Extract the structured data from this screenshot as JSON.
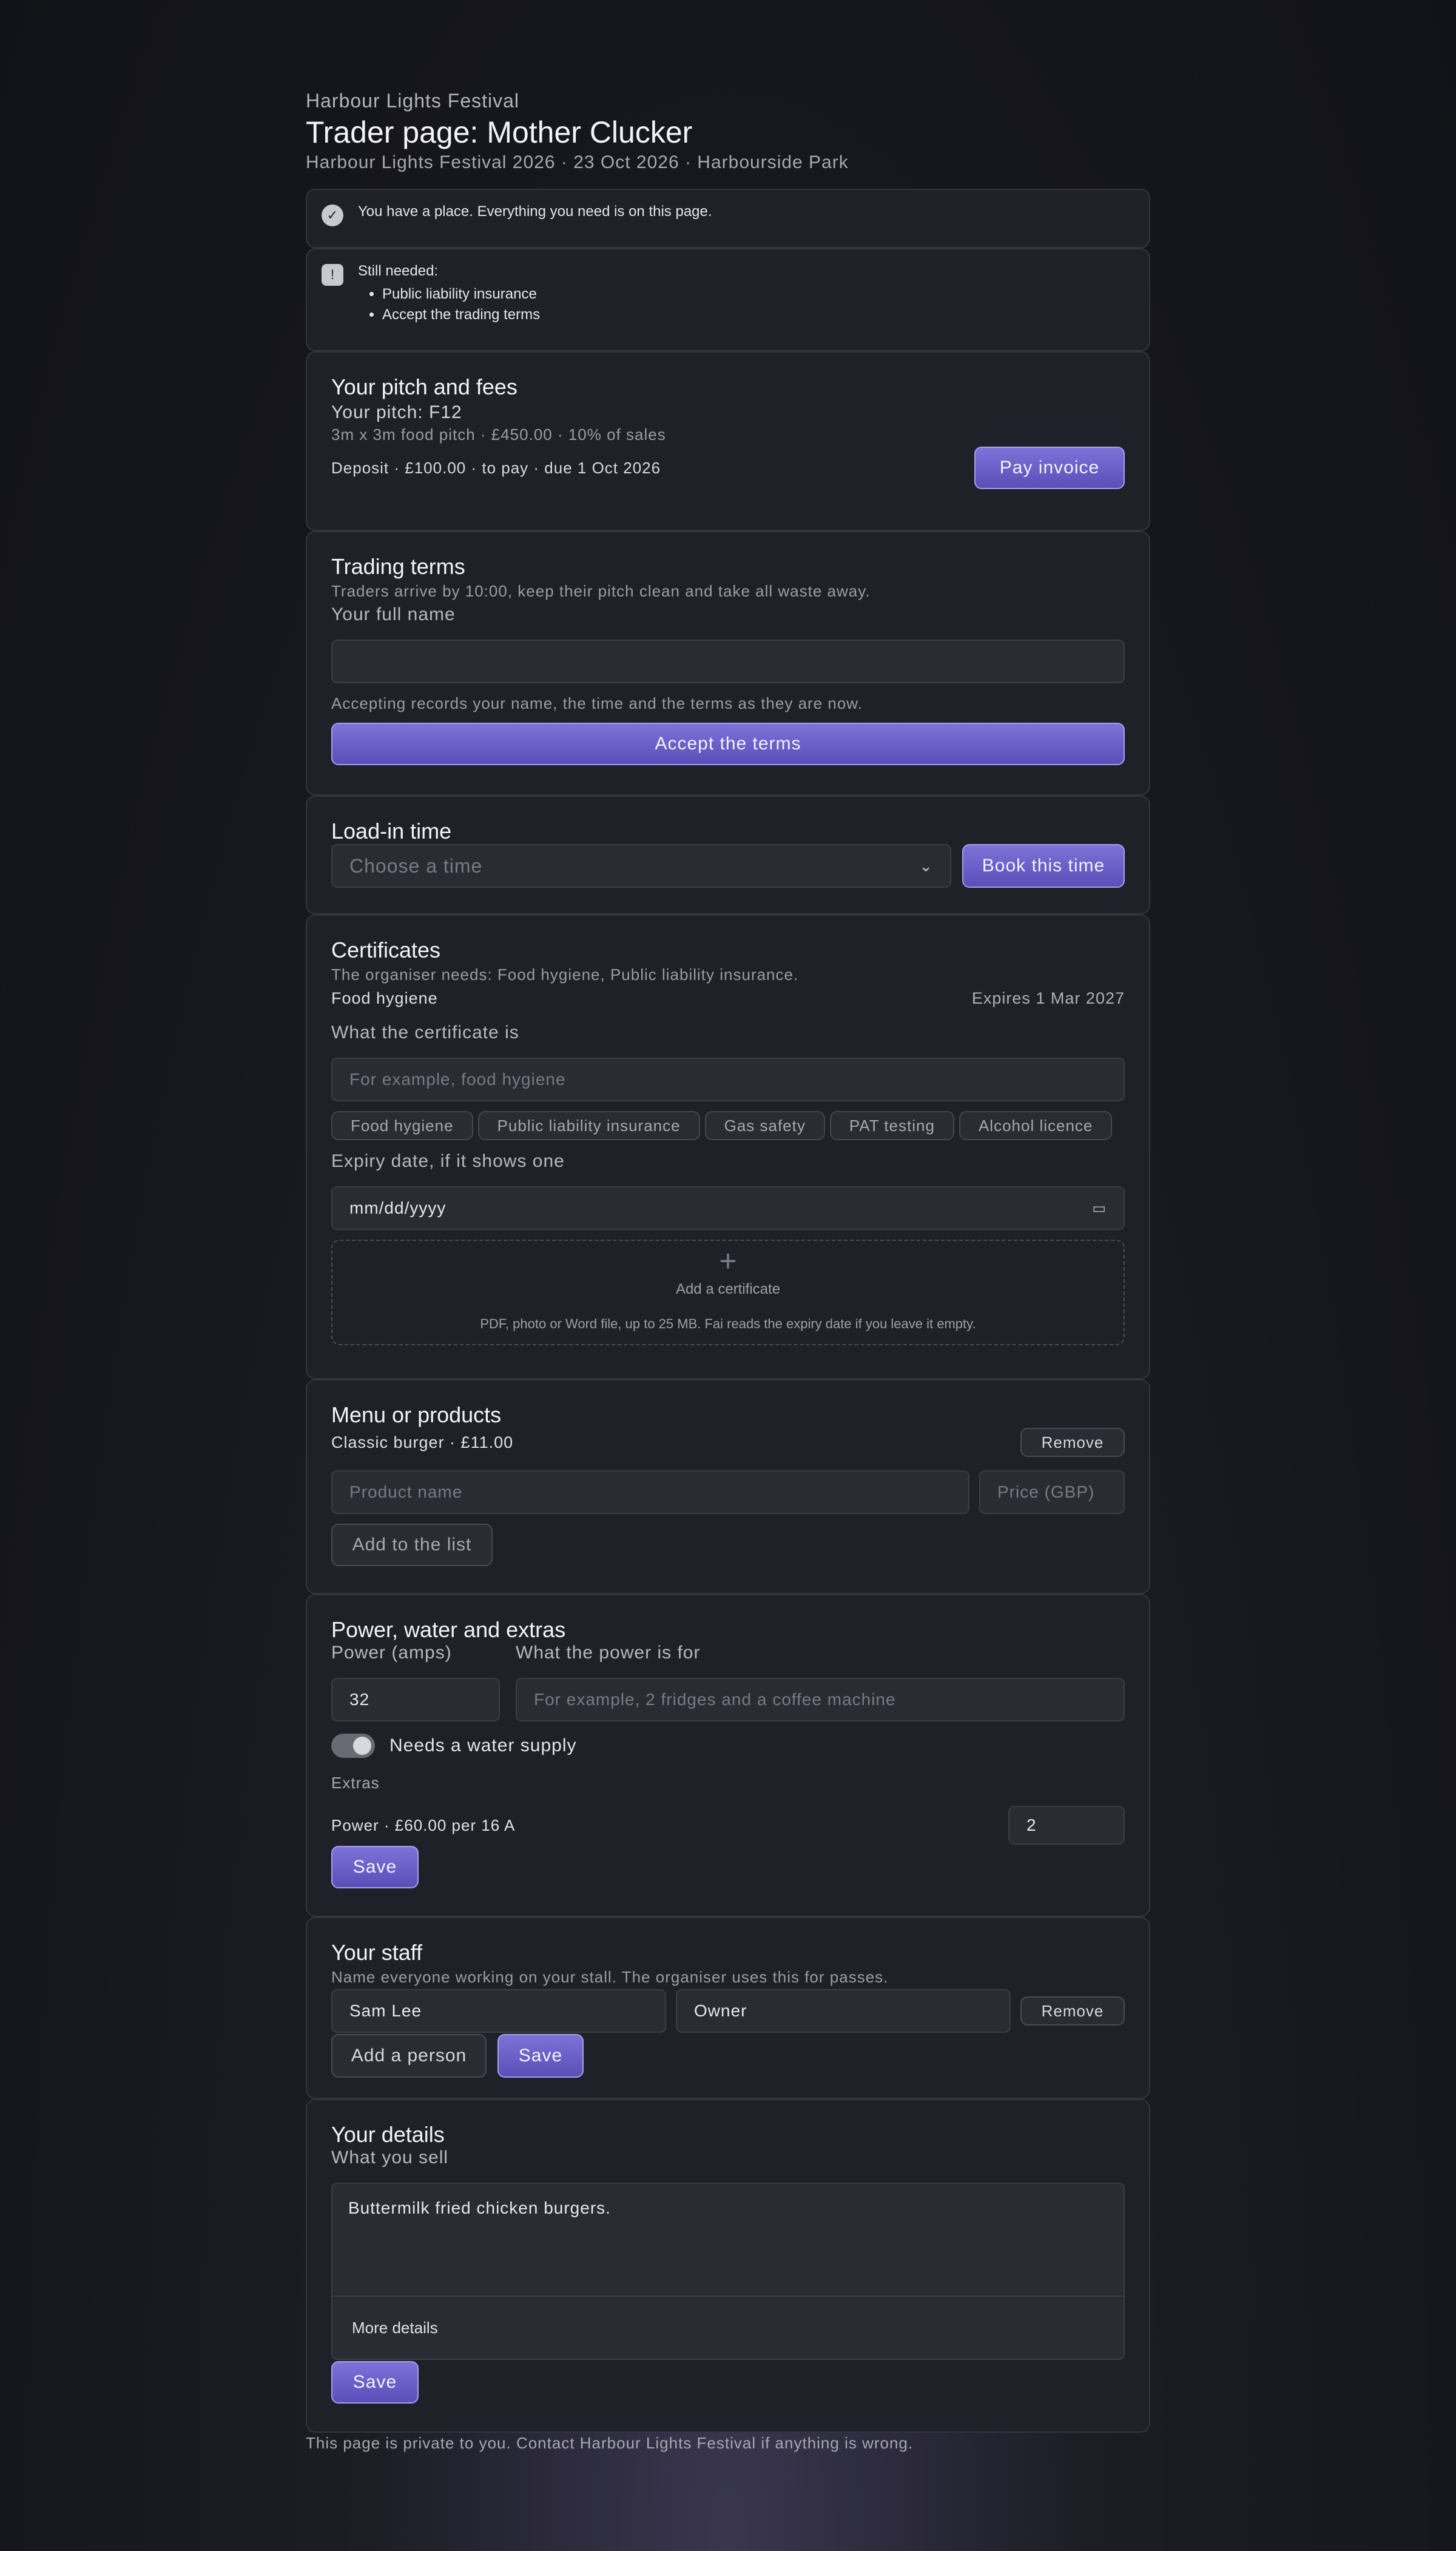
{
  "header": {
    "eyebrow": "Harbour Lights Festival",
    "title": "Trader page: Mother Clucker",
    "subtitle": "Harbour Lights Festival 2026 · 23 Oct 2026 · Harbourside Park"
  },
  "notices": {
    "place": "You have a place. Everything you need is on this page.",
    "still_needed_title": "Still needed:",
    "still_needed_items": [
      "Public liability insurance",
      "Accept the trading terms"
    ]
  },
  "pitch": {
    "title": "Your pitch and fees",
    "pitch": "Your pitch: F12",
    "details": "3m x 3m food pitch · £450.00 · 10% of sales",
    "deposit": "Deposit · £100.00 · to pay · due 1 Oct 2026",
    "pay_button": "Pay invoice"
  },
  "terms": {
    "title": "Trading terms",
    "text": "Traders arrive by 10:00, keep their pitch clean and take all waste away.",
    "name_label": "Your full name",
    "name_value": "",
    "note": "Accepting records your name, the time and the terms as they are now.",
    "accept_button": "Accept the terms"
  },
  "loadin": {
    "title": "Load-in time",
    "select_placeholder": "Choose a time",
    "book_button": "Book this time"
  },
  "certs": {
    "title": "Certificates",
    "needs": "The organiser needs: Food hygiene, Public liability insurance.",
    "existing_name": "Food hygiene",
    "existing_expiry": "Expires 1 Mar 2027",
    "what_label": "What the certificate is",
    "what_placeholder": "For example, food hygiene",
    "chips": [
      "Food hygiene",
      "Public liability insurance",
      "Gas safety",
      "PAT testing",
      "Alcohol licence"
    ],
    "expiry_label": "Expiry date, if it shows one",
    "expiry_placeholder": "mm/dd/yyyy",
    "upload_title": "Add a certificate",
    "upload_note": "PDF, photo or Word file, up to 25 MB. Fai reads the expiry date if you leave it empty."
  },
  "menu": {
    "title": "Menu or products",
    "item": "Classic burger · £11.00",
    "remove": "Remove",
    "product_placeholder": "Product name",
    "price_placeholder": "Price (GBP)",
    "add_button": "Add to the list"
  },
  "power": {
    "title": "Power, water and extras",
    "amps_label": "Power (amps)",
    "amps_value": "32",
    "purpose_label": "What the power is for",
    "purpose_placeholder": "For example, 2 fridges and a coffee machine",
    "water_label": "Needs a water supply",
    "water_on": true,
    "extras_label": "Extras",
    "extra_item": "Power · £60.00 per 16 A",
    "extra_qty": "2",
    "save": "Save"
  },
  "staff": {
    "title": "Your staff",
    "note": "Name everyone working on your stall. The organiser uses this for passes.",
    "person_name": "Sam Lee",
    "person_role": "Owner",
    "remove": "Remove",
    "add_button": "Add a person",
    "save": "Save"
  },
  "details": {
    "title": "Your details",
    "sell_label": "What you sell",
    "sell_value": "Buttermilk fried chicken burgers.",
    "more": "More details",
    "save": "Save"
  },
  "footer": "This page is private to you. Contact Harbour Lights Festival if anything is wrong.",
  "colors": {
    "accent": "#6c62c8",
    "background": "#16171d",
    "card": "#1f2028"
  }
}
